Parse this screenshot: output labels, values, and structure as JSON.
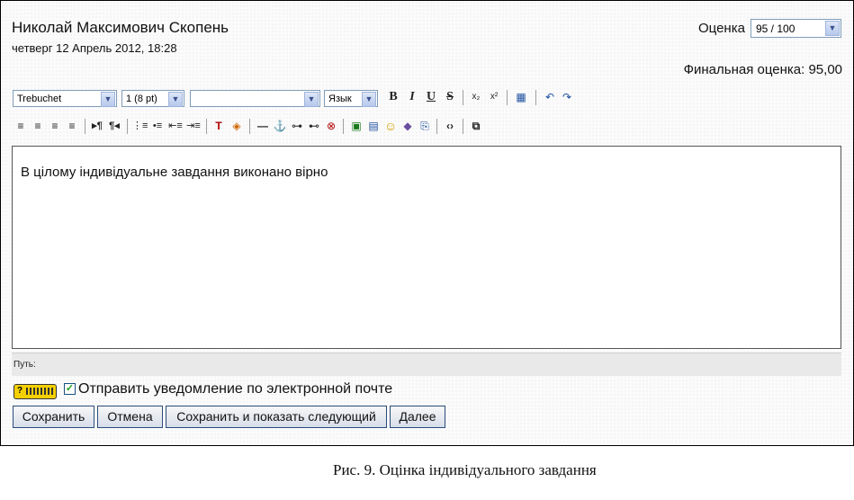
{
  "header": {
    "student_name": "Николай Максимович Скопень",
    "date": "четверг 12 Апрель 2012, 18:28",
    "grade_label": "Оценка",
    "grade_value": "95 / 100",
    "final_grade": "Финальная оценка: 95,00"
  },
  "toolbar": {
    "font_family": "Trebuchet",
    "font_size": "1 (8 pt)",
    "format_value": "",
    "language": "Язык",
    "bold": "B",
    "italic": "I",
    "underline": "U",
    "strike": "S"
  },
  "editor": {
    "content": "В цілому індивідуальне завдання виконано вірно"
  },
  "pathbar": {
    "label": "Путь:"
  },
  "notify_label": "Отправить уведомление по электронной почте",
  "buttons": {
    "save": "Сохранить",
    "cancel": "Отмена",
    "save_next": "Сохранить и показать следующий",
    "next": "Далее"
  },
  "caption": "Рис. 9. Оцінка індивідуального завдання"
}
